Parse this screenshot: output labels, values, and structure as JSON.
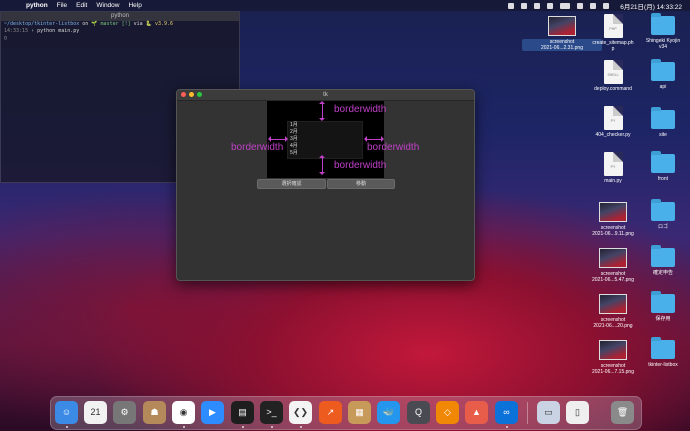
{
  "menubar": {
    "app": "python",
    "items": [
      "File",
      "Edit",
      "Window",
      "Help"
    ],
    "datetime": "6月21日(月) 14:33:22"
  },
  "terminal": {
    "title": "python",
    "line1_path": "~/desktop/tkinter-listbox",
    "line1_on": " on ",
    "line1_git": "🌱 master [!]",
    "line1_via": " via ",
    "line1_ver": "🐍 v3.9.6",
    "line2_time": "14:33:15",
    "line2_cmd": " › python main.py",
    "line3": "▯"
  },
  "tk_window": {
    "title": "tk",
    "list_items": [
      "1月",
      "2月",
      "3月",
      "4月",
      "5月"
    ],
    "labels": {
      "top": "borderwidth",
      "left": "borderwidth",
      "right": "borderwidth",
      "bottom": "borderwidth"
    },
    "buttons": {
      "confirm": "選択確認",
      "move": "移動"
    }
  },
  "desktop": {
    "screenshot_top": "screenshot\n2021-06...2.31.png",
    "col1": [
      {
        "label": "create_sitemap.ph\np",
        "tag": "PHP"
      },
      {
        "label": "deploy.command",
        "tag": "SHELL"
      },
      {
        "label": "404_checker.py",
        "tag": "PY"
      },
      {
        "label": "main.py",
        "tag": "PY"
      },
      {
        "label": "screenshot\n2021-06...9.11.png"
      },
      {
        "label": "screenshot\n2021-06...5.47.png"
      },
      {
        "label": "screenshot\n2021-06....20.png"
      },
      {
        "label": "screenshot\n2021-06...7.15.png"
      }
    ],
    "col2": [
      "Shingeki Kyojin\nv34",
      "api",
      "site",
      "front",
      "ロゴ",
      "確定申告",
      "保存用",
      "tkinter-listbox"
    ]
  },
  "dock": {
    "items": [
      {
        "name": "finder-icon",
        "bg": "#3b8be6",
        "glyph": "☺"
      },
      {
        "name": "calendar-icon",
        "bg": "#f2f2f2",
        "glyph": "21",
        "sub": "6月"
      },
      {
        "name": "system-preferences-icon",
        "bg": "#777",
        "glyph": "⚙"
      },
      {
        "name": "contacts-icon",
        "bg": "#b58a5a",
        "glyph": "☗"
      },
      {
        "name": "chrome-icon",
        "bg": "#ffffff",
        "glyph": "◉"
      },
      {
        "name": "zoom-icon",
        "bg": "#2d8cff",
        "glyph": "▶"
      },
      {
        "name": "activity-monitor-icon",
        "bg": "#1e1e1e",
        "glyph": "▤"
      },
      {
        "name": "terminal-icon",
        "bg": "#222",
        "glyph": ">_"
      },
      {
        "name": "vscode-icon",
        "bg": "#f4f4f4",
        "glyph": "❮❯"
      },
      {
        "name": "stocks-icon",
        "bg": "#ee5b1f",
        "glyph": "↗"
      },
      {
        "name": "archive-utility-icon",
        "bg": "#c89a5a",
        "glyph": "▦"
      },
      {
        "name": "docker-icon",
        "bg": "#2496ed",
        "glyph": "🐳"
      },
      {
        "name": "quicktime-icon",
        "bg": "#4a4a52",
        "glyph": "Q"
      },
      {
        "name": "drawio-icon",
        "bg": "#f08705",
        "glyph": "◇"
      },
      {
        "name": "keynote-icon",
        "bg": "#e85d4a",
        "glyph": "▲"
      },
      {
        "name": "infinity-app-icon",
        "bg": "#0a72d8",
        "glyph": "∞"
      },
      {
        "name": "screenshot-stack-icon",
        "bg": "#c9d3e3",
        "glyph": "▭"
      },
      {
        "name": "downloads-stack-icon",
        "bg": "#efefef",
        "glyph": "▯"
      },
      {
        "name": "trash-icon",
        "bg": "#8a8a8a",
        "glyph": "🗑"
      }
    ]
  },
  "colors": {
    "accent_magenta": "#c040c8",
    "tk_bg": "#333333"
  }
}
